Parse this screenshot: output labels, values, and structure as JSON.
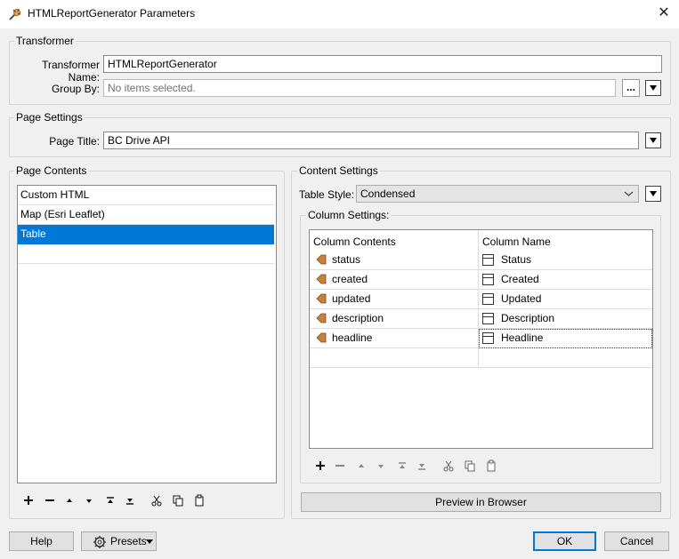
{
  "window": {
    "title": "HTMLReportGenerator Parameters",
    "close_glyph": "✕"
  },
  "transformer": {
    "group_label": "Transformer",
    "name_label": "Transformer Name:",
    "name_value": "HTMLReportGenerator",
    "groupby_label": "Group By:",
    "groupby_placeholder": "No items selected.",
    "browse_label": "..."
  },
  "page_settings": {
    "group_label": "Page Settings",
    "title_label": "Page Title:",
    "title_value": "BC Drive API"
  },
  "page_contents": {
    "group_label": "Page Contents",
    "items": [
      {
        "label": "Custom HTML"
      },
      {
        "label": "Map (Esri Leaflet)"
      },
      {
        "label": "Table"
      }
    ],
    "selected_index": 2
  },
  "toolbar_icons": [
    "plus-icon",
    "minus-icon",
    "move-up-icon",
    "move-down-icon",
    "move-to-top-icon",
    "move-to-bottom-icon",
    "cut-icon",
    "copy-icon",
    "paste-icon"
  ],
  "content_settings": {
    "group_label": "Content Settings",
    "table_style_label": "Table Style:",
    "table_style_value": "Condensed",
    "column_settings_label": "Column Settings:",
    "columns_header": [
      "Column Contents",
      "Column Name"
    ],
    "rows": [
      {
        "attribute": "status",
        "name": "Status"
      },
      {
        "attribute": "created",
        "name": "Created"
      },
      {
        "attribute": "updated",
        "name": "Updated"
      },
      {
        "attribute": "description",
        "name": "Description"
      },
      {
        "attribute": "headline",
        "name": "Headline"
      }
    ],
    "preview_button": "Preview in Browser"
  },
  "footer": {
    "help_button": "Help",
    "presets_button": "Presets",
    "ok_button": "OK",
    "cancel_button": "Cancel"
  },
  "colors": {
    "selection": "#0078d7",
    "attribute_icon": "#c8813a",
    "dialog_bg": "#f0f0f0"
  }
}
